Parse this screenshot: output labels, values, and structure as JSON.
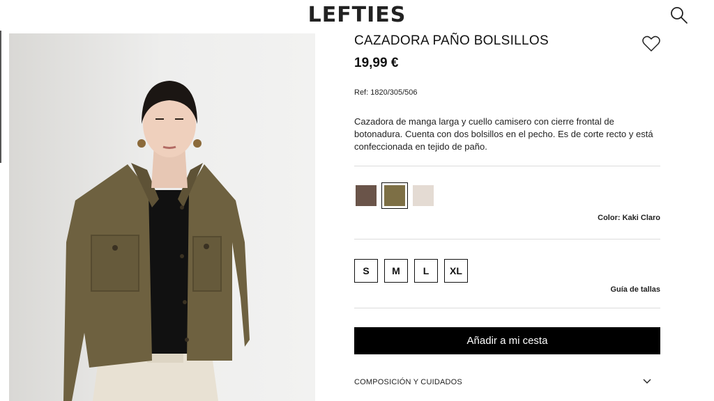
{
  "header": {
    "logo": "LEFTIES"
  },
  "product": {
    "title": "CAZADORA PAÑO BOLSILLOS",
    "price": "19,99 €",
    "ref": "Ref: 1820/305/506",
    "description": "Cazadora de manga larga y cuello camisero con cierre frontal de botonadura. Cuenta con dos bolsillos en el pecho. Es de corte recto y está confeccionada en tejido de paño."
  },
  "colors": {
    "swatches": [
      {
        "hex": "#6a5449",
        "selected": false
      },
      {
        "hex": "#7d6f45",
        "selected": true
      },
      {
        "hex": "#e4dbd3",
        "selected": false
      }
    ],
    "label": "Color: Kaki Claro"
  },
  "sizes": {
    "options": [
      "S",
      "M",
      "L",
      "XL"
    ],
    "guide": "Guía de tallas"
  },
  "actions": {
    "add_to_cart": "Añadir a mi cesta"
  },
  "accordion": {
    "composition": "COMPOSICIÓN Y CUIDADOS"
  }
}
